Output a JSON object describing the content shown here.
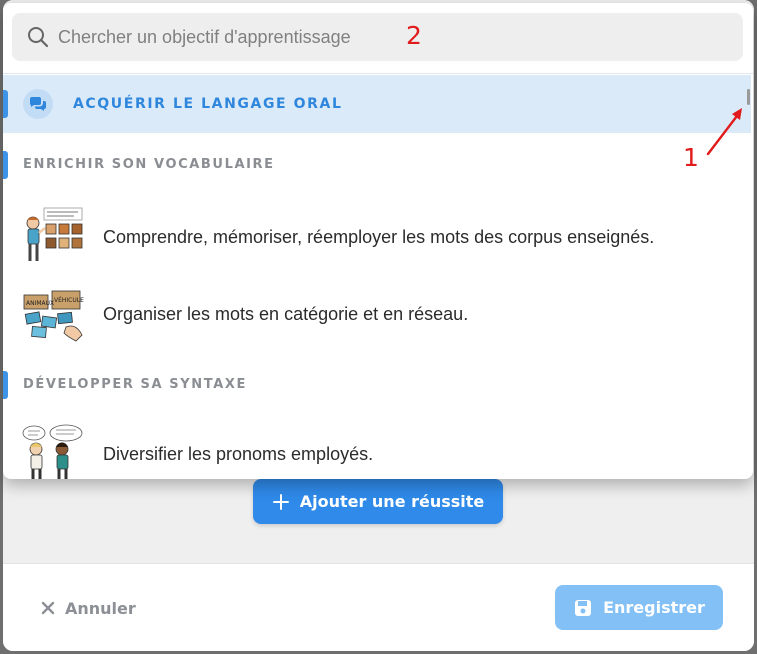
{
  "search": {
    "placeholder": "Chercher un objectif d'apprentissage"
  },
  "annotations": {
    "label_1": "1",
    "label_2": "2",
    "color": "#e11b1b"
  },
  "list": {
    "selected": {
      "label": "ACQUÉRIR LE LANGAGE ORAL",
      "icon": "chat-bubbles-icon"
    },
    "groups": [
      {
        "title": "ENRICHIR SON VOCABULAIRE",
        "items": [
          {
            "label": "Comprendre, mémoriser, réemployer les mots des corpus enseignés."
          },
          {
            "label": "Organiser les mots en catégorie et en réseau."
          }
        ]
      },
      {
        "title": "DÉVELOPPER SA SYNTAXE",
        "items": [
          {
            "label": "Diversifier les pronoms employés."
          }
        ]
      }
    ]
  },
  "modal": {
    "add_success_label": "Ajouter une réussite",
    "cancel_label": "Annuler",
    "save_label": "Enregistrer"
  },
  "colors": {
    "accent": "#2f8ae9",
    "selected_bg": "#daeaf8",
    "save_disabled": "#83c0f6"
  }
}
